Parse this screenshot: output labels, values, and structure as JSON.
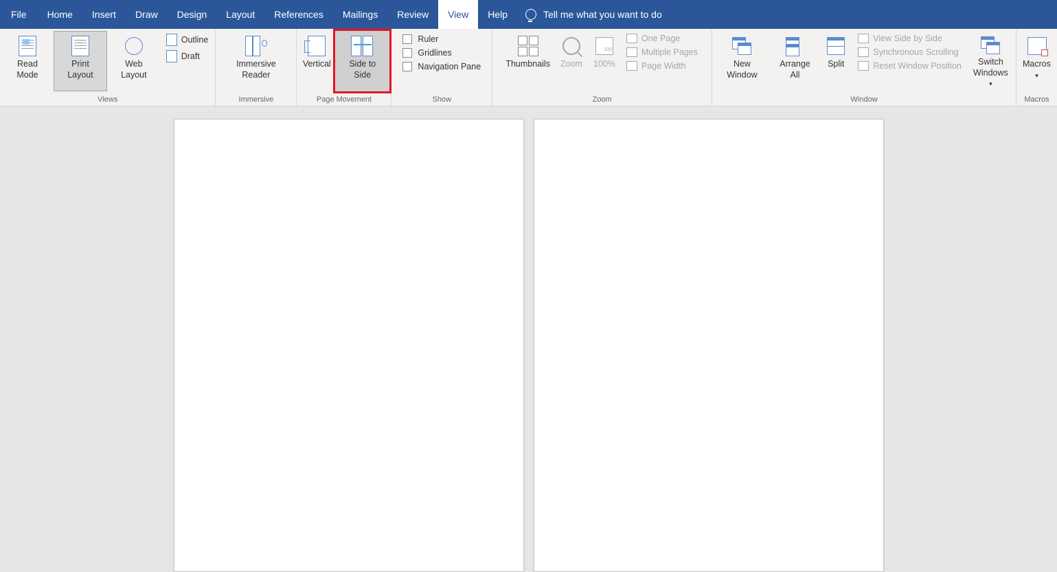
{
  "menubar": {
    "file": "File",
    "tabs": [
      "Home",
      "Insert",
      "Draw",
      "Design",
      "Layout",
      "References",
      "Mailings",
      "Review",
      "View",
      "Help"
    ],
    "active_tab": "View",
    "tell_me": "Tell me what you want to do"
  },
  "ribbon": {
    "views": {
      "label": "Views",
      "read_mode": "Read Mode",
      "print_layout": "Print Layout",
      "web_layout": "Web Layout",
      "outline": "Outline",
      "draft": "Draft"
    },
    "immersive": {
      "label": "Immersive",
      "immersive_reader": "Immersive Reader"
    },
    "page_movement": {
      "label": "Page Movement",
      "vertical": "Vertical",
      "side_to_side": "Side to Side"
    },
    "show": {
      "label": "Show",
      "ruler": "Ruler",
      "gridlines": "Gridlines",
      "navigation_pane": "Navigation Pane"
    },
    "zoom": {
      "label": "Zoom",
      "thumbnails": "Thumbnails",
      "zoom": "Zoom",
      "hundred": "100%",
      "one_page": "One Page",
      "multiple_pages": "Multiple Pages",
      "page_width": "Page Width"
    },
    "window": {
      "label": "Window",
      "new_window": "New Window",
      "arrange_all": "Arrange All",
      "split": "Split",
      "view_side_by_side": "View Side by Side",
      "synchronous_scrolling": "Synchronous Scrolling",
      "reset_window_position": "Reset Window Position",
      "switch_windows": "Switch Windows"
    },
    "macros": {
      "label": "Macros",
      "macros": "Macros"
    }
  }
}
